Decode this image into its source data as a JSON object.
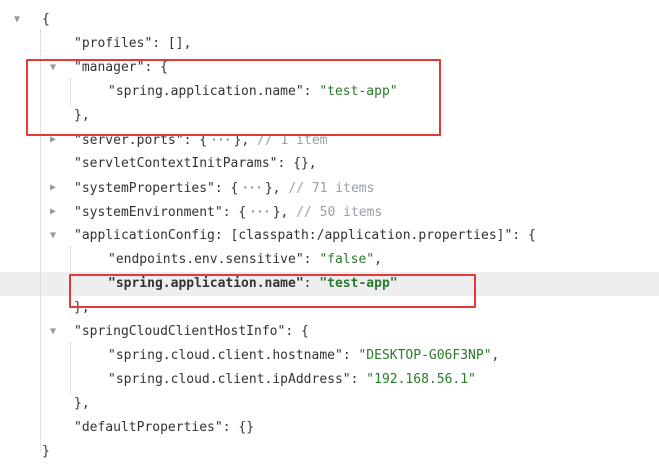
{
  "rows": [
    {
      "toggle": "expanded",
      "indent": 0,
      "parts": [
        {
          "t": "{",
          "c": "p"
        }
      ]
    },
    {
      "indent": 1,
      "parts": [
        {
          "t": "\"profiles\"",
          "c": "k"
        },
        {
          "t": ":  [],",
          "c": "p"
        }
      ]
    },
    {
      "toggle": "expanded",
      "indent": 1,
      "parts": [
        {
          "t": "\"manager\"",
          "c": "k"
        },
        {
          "t": ":  {",
          "c": "p"
        }
      ]
    },
    {
      "indent": 2,
      "parts": [
        {
          "t": "\"spring.application.name\"",
          "c": "k"
        },
        {
          "t": ":  ",
          "c": "p"
        },
        {
          "t": "\"test-app\"",
          "c": "s"
        }
      ]
    },
    {
      "indent": 1,
      "parts": [
        {
          "t": "},",
          "c": "p"
        }
      ]
    },
    {
      "toggle": "collapsed",
      "indent": 1,
      "parts": [
        {
          "t": "\"server.ports\"",
          "c": "k"
        },
        {
          "t": ":  {",
          "c": "p"
        },
        {
          "t": "···",
          "c": "e"
        },
        {
          "t": "}, ",
          "c": "p"
        },
        {
          "t": "// 1 item",
          "c": "c"
        }
      ]
    },
    {
      "indent": 1,
      "parts": [
        {
          "t": "\"servletContextInitParams\"",
          "c": "k"
        },
        {
          "t": ":  {},",
          "c": "p"
        }
      ]
    },
    {
      "toggle": "collapsed",
      "indent": 1,
      "parts": [
        {
          "t": "\"systemProperties\"",
          "c": "k"
        },
        {
          "t": ":  {",
          "c": "p"
        },
        {
          "t": "···",
          "c": "e"
        },
        {
          "t": "}, ",
          "c": "p"
        },
        {
          "t": "// 71 items",
          "c": "c"
        }
      ]
    },
    {
      "toggle": "collapsed",
      "indent": 1,
      "parts": [
        {
          "t": "\"systemEnvironment\"",
          "c": "k"
        },
        {
          "t": ":  {",
          "c": "p"
        },
        {
          "t": "···",
          "c": "e"
        },
        {
          "t": "}, ",
          "c": "p"
        },
        {
          "t": "// 50 items",
          "c": "c"
        }
      ]
    },
    {
      "toggle": "expanded",
      "indent": 1,
      "parts": [
        {
          "t": "\"applicationConfig: [classpath:/application.properties]\"",
          "c": "k"
        },
        {
          "t": ":  {",
          "c": "p"
        }
      ]
    },
    {
      "indent": 2,
      "parts": [
        {
          "t": "\"endpoints.env.sensitive\"",
          "c": "k"
        },
        {
          "t": ":  ",
          "c": "p"
        },
        {
          "t": "\"false\"",
          "c": "s"
        },
        {
          "t": ",",
          "c": "p"
        }
      ]
    },
    {
      "indent": 2,
      "bold": true,
      "highlight": true,
      "parts": [
        {
          "t": "\"spring.application.name\"",
          "c": "k"
        },
        {
          "t": ":  ",
          "c": "p"
        },
        {
          "t": "\"test-app\"",
          "c": "s"
        }
      ]
    },
    {
      "indent": 1,
      "parts": [
        {
          "t": "},",
          "c": "p"
        }
      ]
    },
    {
      "toggle": "expanded",
      "indent": 1,
      "parts": [
        {
          "t": "\"springCloudClientHostInfo\"",
          "c": "k"
        },
        {
          "t": ":  {",
          "c": "p"
        }
      ]
    },
    {
      "indent": 2,
      "parts": [
        {
          "t": "\"spring.cloud.client.hostname\"",
          "c": "k"
        },
        {
          "t": ":  ",
          "c": "p"
        },
        {
          "t": "\"DESKTOP-G06F3NP\"",
          "c": "s"
        },
        {
          "t": ",",
          "c": "p"
        }
      ]
    },
    {
      "indent": 2,
      "parts": [
        {
          "t": "\"spring.cloud.client.ipAddress\"",
          "c": "k"
        },
        {
          "t": ":  ",
          "c": "p"
        },
        {
          "t": "\"192.168.56.1\"",
          "c": "s"
        }
      ]
    },
    {
      "indent": 1,
      "parts": [
        {
          "t": "},",
          "c": "p"
        }
      ]
    },
    {
      "indent": 1,
      "parts": [
        {
          "t": "\"defaultProperties\"",
          "c": "k"
        },
        {
          "t": ":  {}",
          "c": "p"
        }
      ]
    },
    {
      "indent": 0,
      "parts": [
        {
          "t": "}",
          "c": "p"
        }
      ]
    }
  ],
  "colors": {
    "string": "#2b7a2b",
    "comment": "#9aa0a6",
    "annotation_box": "#e53935",
    "row_highlight": "#eeeeee"
  },
  "icons": {
    "expanded": "triangle-down-icon",
    "collapsed": "triangle-right-icon"
  }
}
